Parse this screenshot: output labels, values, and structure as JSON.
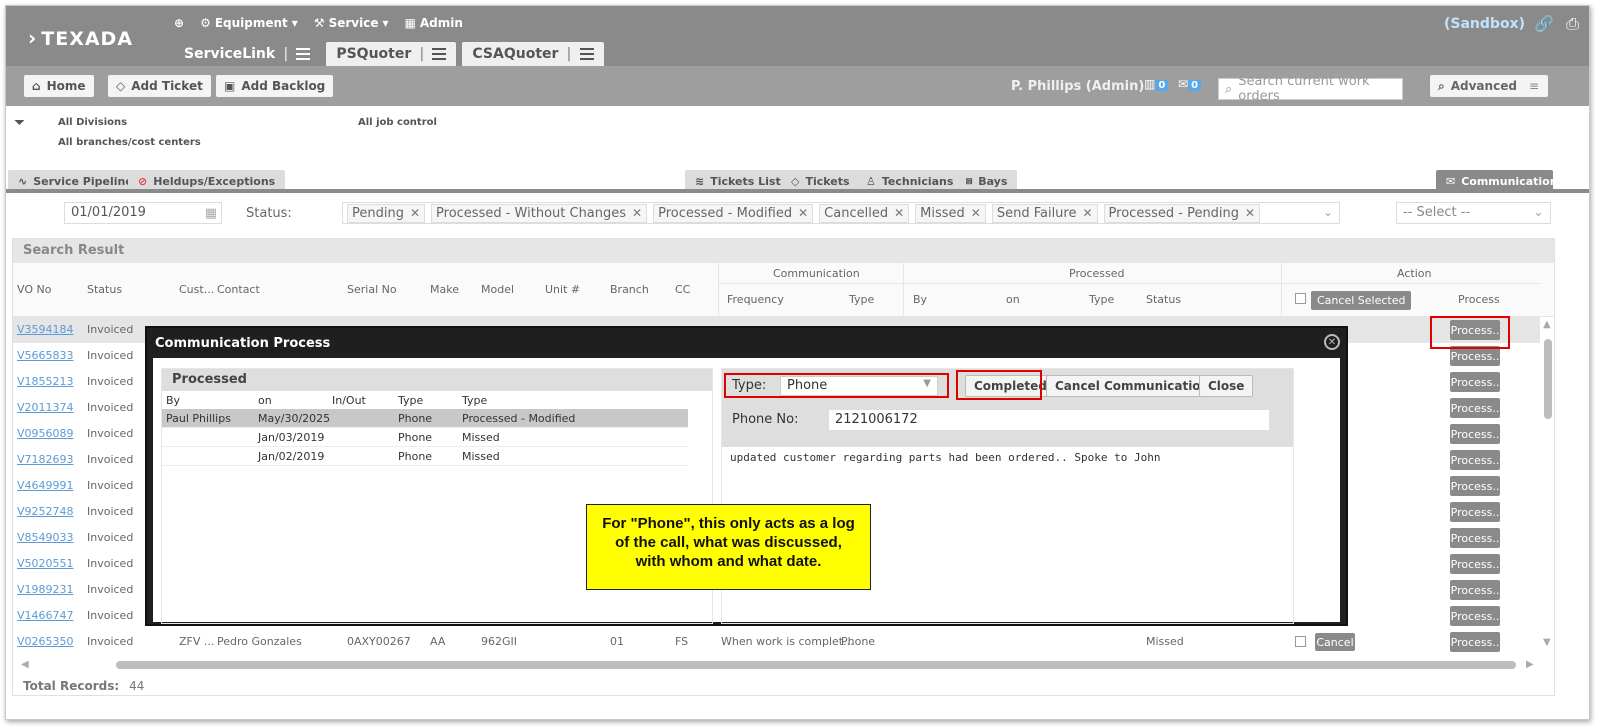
{
  "app": {
    "logo": "TEXADA",
    "nav": [
      "Equipment",
      "Service",
      "Admin"
    ],
    "apptabs": [
      "ServiceLink",
      "PSQuoter",
      "CSAQuoter"
    ],
    "sandbox": "(Sandbox)"
  },
  "toolbar": {
    "home": "Home",
    "add_ticket": "Add Ticket",
    "add_backlog": "Add Backlog",
    "user": "P. Phillips (Admin)",
    "badge1": "0",
    "badge2": "0",
    "search_placeholder": "Search current work orders",
    "advanced": "Advanced"
  },
  "filters": {
    "divisions": "All Divisions",
    "branches": "All branches/cost centers",
    "job_control": "All job control"
  },
  "subtabs": {
    "service_pipeline": "Service Pipeline",
    "heldups": "Heldups/Exceptions",
    "tickets_list": "Tickets List",
    "tickets": "Tickets",
    "technicians": "Technicians",
    "bays": "Bays",
    "communication": "Communication"
  },
  "status_filter": {
    "date": "01/01/2019",
    "label": "Status:",
    "chips": [
      "Pending",
      "Processed - Without Changes",
      "Processed - Modified",
      "Cancelled",
      "Missed",
      "Send Failure",
      "Processed - Pending"
    ],
    "select": "-- Select --"
  },
  "results": {
    "title": "Search Result",
    "headers": {
      "wo": "VO No",
      "status": "Status",
      "cust": "Cust...",
      "contact": "Contact",
      "serial": "Serial No",
      "make": "Make",
      "model": "Model",
      "unit": "Unit #",
      "branch": "Branch",
      "cc": "CC",
      "communication": "Communication",
      "frequency": "Frequency",
      "type": "Type",
      "processed": "Processed",
      "by": "By",
      "on": "on",
      "ptype": "Type",
      "pstatus": "Status",
      "action": "Action",
      "cancel_selected": "Cancel Selected",
      "process": "Process"
    },
    "rows": [
      {
        "wo": "V3594184",
        "status": "Invoiced"
      },
      {
        "wo": "V5665833",
        "status": "Invoiced"
      },
      {
        "wo": "V1855213",
        "status": "Invoiced"
      },
      {
        "wo": "V2011374",
        "status": "Invoiced"
      },
      {
        "wo": "V0956089",
        "status": "Invoiced"
      },
      {
        "wo": "V7182693",
        "status": "Invoiced"
      },
      {
        "wo": "V4649991",
        "status": "Invoiced"
      },
      {
        "wo": "V9252748",
        "status": "Invoiced"
      },
      {
        "wo": "V8549033",
        "status": "Invoiced"
      },
      {
        "wo": "V5020551",
        "status": "Invoiced"
      },
      {
        "wo": "V1989231",
        "status": "Invoiced"
      },
      {
        "wo": "V1466747",
        "status": "Invoiced"
      }
    ],
    "last_row": {
      "wo": "V0265350",
      "status": "Invoiced",
      "cust": "ZFV ...",
      "contact": "Pedro Gonzales",
      "serial": "0AXY00267",
      "make": "AA",
      "model": "962GII",
      "branch": "01",
      "cc": "FS",
      "frequency": "When work is complet...",
      "type": "Phone",
      "pstatus": "Missed",
      "cancel": "Cancel"
    },
    "process_label": "Process..",
    "total_label": "Total Records:",
    "total_value": "44"
  },
  "modal": {
    "title": "Communication Process",
    "processed_title": "Processed",
    "headers": [
      "By",
      "on",
      "In/Out",
      "Type",
      "Type"
    ],
    "rows": [
      {
        "by": "Paul Phillips",
        "on": "May/30/2025",
        "inout": "",
        "type": "Phone",
        "status": "Processed - Modified"
      },
      {
        "by": "",
        "on": "Jan/03/2019",
        "inout": "",
        "type": "Phone",
        "status": "Missed"
      },
      {
        "by": "",
        "on": "Jan/02/2019",
        "inout": "",
        "type": "Phone",
        "status": "Missed"
      }
    ],
    "type_label": "Type:",
    "type_value": "Phone",
    "completed": "Completed",
    "cancel_comm": "Cancel Communication",
    "close": "Close",
    "phone_label": "Phone No:",
    "phone_value": "2121006172",
    "notes": "updated customer regarding parts had been ordered..  Spoke to John"
  },
  "callout": "For \"Phone\", this only acts as a log of the call, what was discussed, with whom and what date.",
  "colors": {
    "topbar": "#8a8a8a",
    "link": "#5b9bd5",
    "highlight": "#e00000",
    "callout": "#ffff00"
  }
}
